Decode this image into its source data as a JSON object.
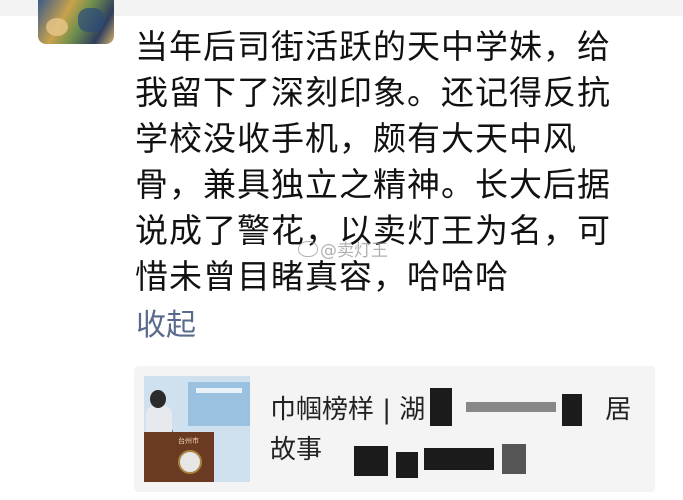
{
  "post": {
    "lines": [
      "当年后司街活跃的天中学妹，给",
      "我留下了深刻印象。还记得反抗",
      "学校没收手机，颇有大天中风",
      "骨，兼具独立之精神。长大后据",
      "说成了警花，以卖灯王为名，可",
      "惜未曾目睹真容，哈哈哈"
    ],
    "collapse_label": "收起"
  },
  "watermark": {
    "text": "@卖灯王"
  },
  "share_card": {
    "title_line1": "巾帼榜样 | 湖",
    "title_line1_tail": "居",
    "title_line2": "故事"
  },
  "thumbnail": {
    "podium_text": "台州市"
  },
  "colors": {
    "link": "#5a6a8c",
    "card_bg": "#f4f4f4",
    "text": "#111111"
  }
}
